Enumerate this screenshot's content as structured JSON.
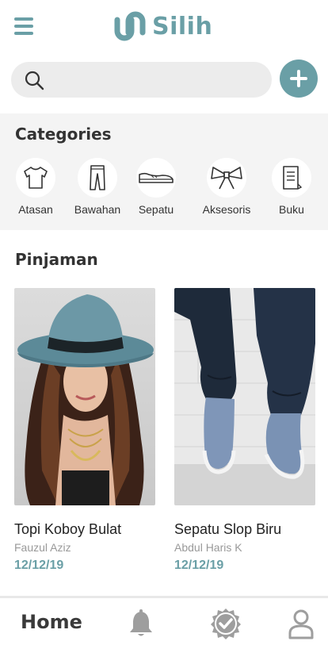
{
  "app": {
    "name": "Silih",
    "accent_color": "#6a9fa6"
  },
  "search": {
    "placeholder": "",
    "value": ""
  },
  "categories": {
    "title": "Categories",
    "items": [
      {
        "label": "Atasan",
        "icon": "shirt-icon"
      },
      {
        "label": "Bawahan",
        "icon": "pants-icon"
      },
      {
        "label": "Sepatu",
        "icon": "shoe-icon"
      },
      {
        "label": "Aksesoris",
        "icon": "bow-icon"
      },
      {
        "label": "Buku",
        "icon": "book-icon"
      }
    ]
  },
  "pinjaman": {
    "title": "Pinjaman",
    "items": [
      {
        "title": "Topi Koboy Bulat",
        "owner": "Fauzul Aziz",
        "date": "12/12/19",
        "image": "woman-hat-photo"
      },
      {
        "title": "Sepatu Slop Biru",
        "owner": "Abdul Haris K",
        "date": "12/12/19",
        "image": "blue-slip-on-shoes-photo"
      }
    ]
  },
  "nav": {
    "home_label": "Home",
    "items": [
      "bell-icon",
      "verified-badge-icon",
      "user-icon"
    ]
  }
}
